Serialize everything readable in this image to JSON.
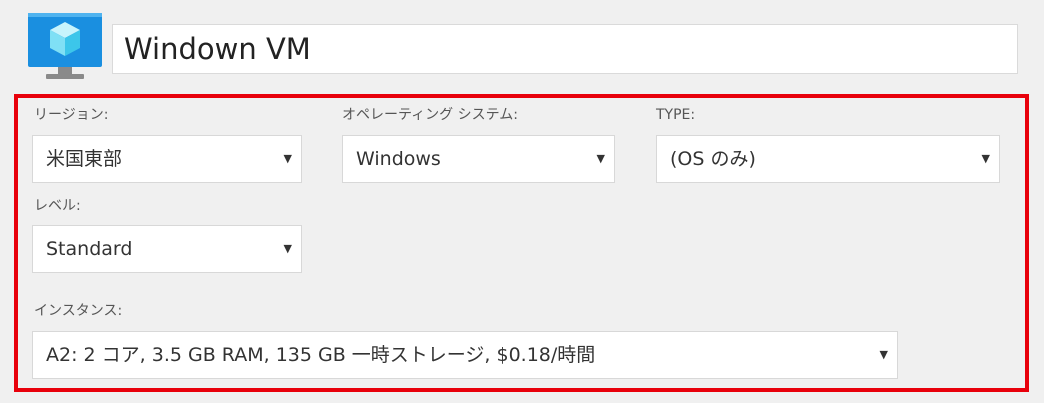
{
  "vm": {
    "icon": "virtual-machine-icon",
    "name": "Windown VM"
  },
  "colors": {
    "highlight_border": "#e8000b",
    "icon_blue": "#1a8fe0",
    "icon_cube": "#7fe0f5"
  },
  "fields": {
    "region": {
      "label": "リージョン:",
      "value": "米国東部"
    },
    "os": {
      "label": "オペレーティング システム:",
      "value": "Windows"
    },
    "type": {
      "label": "TYPE:",
      "value": "(OS のみ)"
    },
    "tier": {
      "label": "レベル:",
      "value": "Standard"
    },
    "instance": {
      "label": "インスタンス:",
      "value": "A2: 2 コア, 3.5 GB RAM, 135 GB 一時ストレージ, $0.18/時間"
    }
  },
  "select_arrow_glyph": "▼"
}
